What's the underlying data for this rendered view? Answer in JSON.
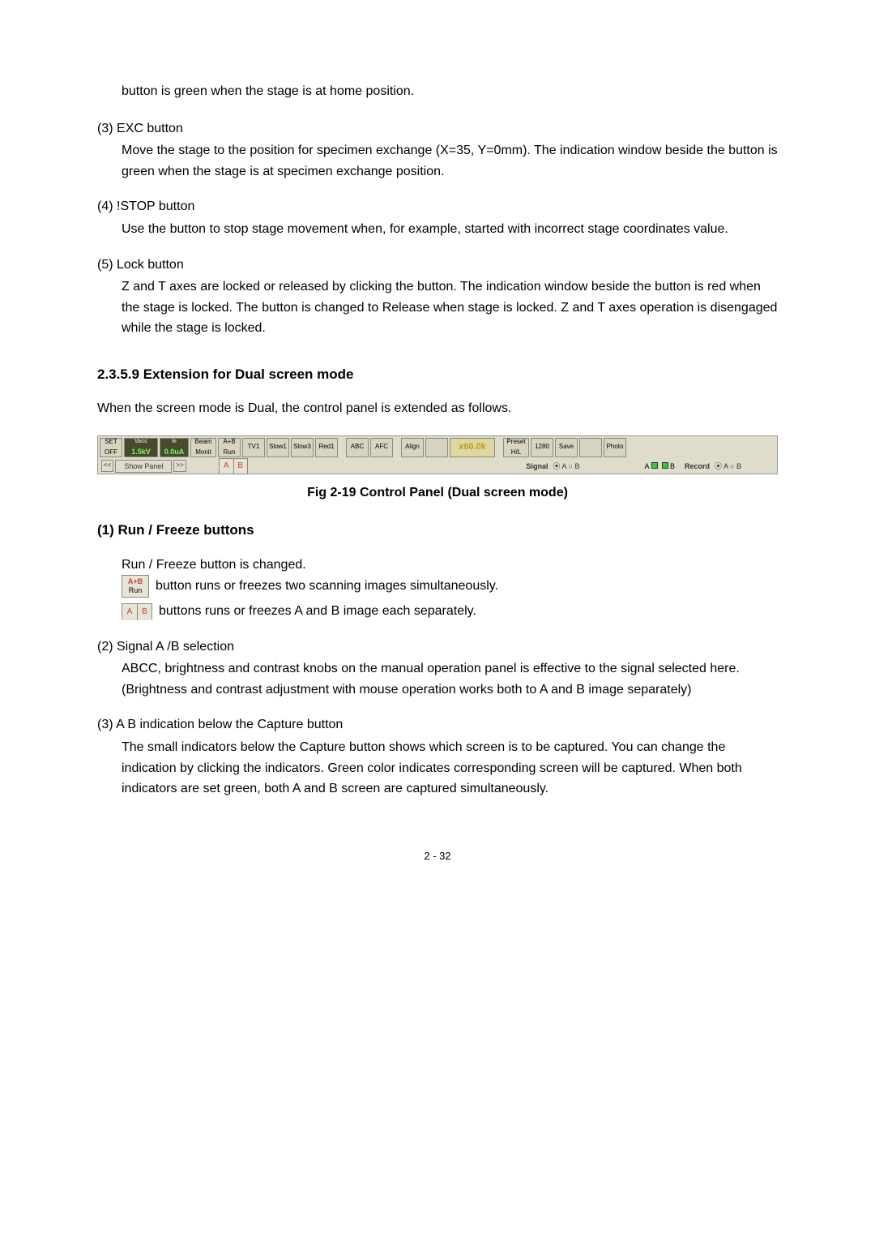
{
  "text": {
    "home_position": "button is green when the stage is at home position.",
    "exc_title": "(3) EXC button",
    "exc_body": "Move the stage to the position for specimen exchange (X=35, Y=0mm). The indication window beside the button is green when the stage is at specimen exchange position.",
    "stop_title": "(4) !STOP button",
    "stop_body": "Use the button to stop stage movement when, for example, started with incorrect stage coordinates value.",
    "lock_title": "(5) Lock button",
    "lock_body": "Z and T axes are locked or released by clicking the button.   The indication window beside the button is red when the stage is locked. The button is changed to Release when stage is locked. Z and T axes operation is disengaged while the stage is locked.",
    "section_heading": "2.3.5.9   Extension for Dual screen mode",
    "dual_intro": "When the screen mode is Dual, the control panel is extended as follows.",
    "fig_caption": "Fig 2-19 Control Panel (Dual screen mode)",
    "run_freeze_heading": "(1) Run / Freeze buttons",
    "run_freeze_changed": "Run / Freeze button is changed.",
    "btn_ab_run_label_top": "A+B",
    "btn_ab_run_label_bottom": "Run",
    "btn_a": "A",
    "btn_b": "B",
    "run_freeze_line1": " button runs or freezes two scanning images simultaneously.",
    "run_freeze_line2": " buttons runs or freezes A and B image each separately.",
    "signal_title": "(2) Signal A /B selection",
    "signal_body1": "ABCC, brightness and contrast knobs on the manual operation panel is effective to the signal selected here.",
    "signal_body2": "(Brightness and contrast adjustment with mouse operation works both to A and B image separately)",
    "ab_ind_title": "(3) A B indication below the Capture button",
    "ab_ind_body": "The small indicators below the Capture button shows which screen is to be captured.   You can change the indication by clicking the indicators.   Green color indicates corresponding screen will be captured.   When both indicators are set green, both A and B screen are captured simultaneously.",
    "page_number": "2 - 32"
  },
  "toolbar": {
    "set": "SET",
    "off": "OFF",
    "vacc": "Vacc",
    "vacc_val": "1.5kV",
    "ie": "Ie",
    "ie_val": "0.0uA",
    "beam": "Beam",
    "monit": "Monit",
    "ab": "A+B",
    "run": "Run",
    "tv1": "TV1",
    "slow1": "Slow1",
    "slow3": "Slow3",
    "red1": "Red1",
    "abc": "ABC",
    "afc": "AFC",
    "align": "Align",
    "mag": "x60.0k",
    "preset": "Preset",
    "hl": "H/L",
    "res": "1280",
    "save": "Save",
    "photo": "Photo",
    "show_panel": "Show Panel",
    "signal": "Signal",
    "record": "Record",
    "a_label": "A",
    "b_label": "B"
  }
}
